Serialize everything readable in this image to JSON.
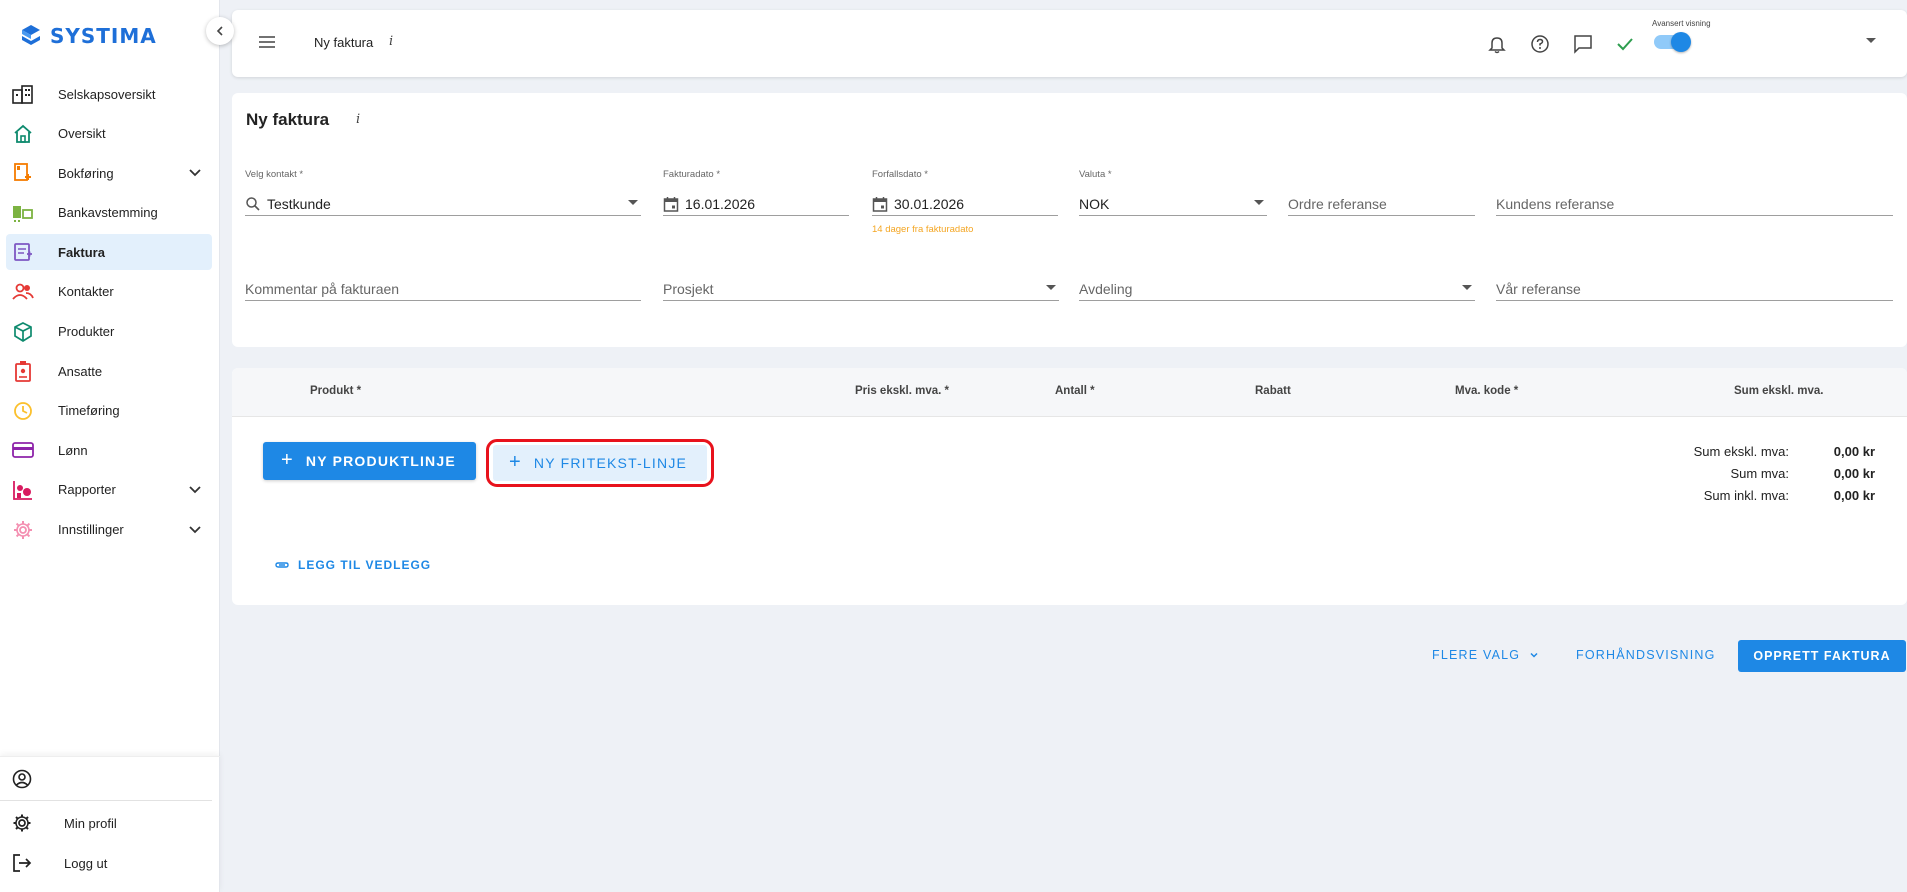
{
  "app": {
    "name": "SYSTIMA"
  },
  "sidebar": {
    "items": [
      {
        "label": "Selskapsoversikt",
        "icon": "buildings-icon",
        "color": "#222222"
      },
      {
        "label": "Oversikt",
        "icon": "home-icon",
        "color": "#0e8a6e"
      },
      {
        "label": "Bokføring",
        "icon": "ledger-icon",
        "color": "#f57c00",
        "expandable": true
      },
      {
        "label": "Bankavstemming",
        "icon": "bank-icon",
        "color": "#7cb342"
      },
      {
        "label": "Faktura",
        "icon": "invoice-icon",
        "color": "#7e57c2",
        "active": true
      },
      {
        "label": "Kontakter",
        "icon": "contacts-icon",
        "color": "#e53935"
      },
      {
        "label": "Produkter",
        "icon": "cube-icon",
        "color": "#0e8a6e"
      },
      {
        "label": "Ansatte",
        "icon": "badge-icon",
        "color": "#e53935"
      },
      {
        "label": "Timeføring",
        "icon": "clock-icon",
        "color": "#fbc02d"
      },
      {
        "label": "Lønn",
        "icon": "card-icon",
        "color": "#8e24aa"
      },
      {
        "label": "Rapporter",
        "icon": "chart-icon",
        "color": "#d81b60",
        "expandable": true
      },
      {
        "label": "Innstillinger",
        "icon": "gear-icon",
        "color": "#f48fb1",
        "expandable": true
      }
    ],
    "bottom": {
      "profile": "Min profil",
      "logout": "Logg ut"
    }
  },
  "topbar": {
    "title": "Ny faktura",
    "info": "i",
    "toggle_label": "Avansert visning",
    "toggle_on": true
  },
  "form": {
    "title": "Ny faktura",
    "info": "i",
    "contact": {
      "label": "Velg kontakt *",
      "value": "Testkunde"
    },
    "invoice_date": {
      "label": "Fakturadato *",
      "value": "16.01.2026"
    },
    "due_date": {
      "label": "Forfallsdato *",
      "value": "30.01.2026",
      "hint": "14 dager fra fakturadato"
    },
    "currency": {
      "label": "Valuta *",
      "value": "NOK"
    },
    "order_ref": {
      "placeholder": "Ordre referanse"
    },
    "customer_ref": {
      "placeholder": "Kundens referanse"
    },
    "comment": {
      "placeholder": "Kommentar på fakturaen"
    },
    "project": {
      "placeholder": "Prosjekt"
    },
    "department": {
      "placeholder": "Avdeling"
    },
    "our_ref": {
      "placeholder": "Vår referanse"
    }
  },
  "lines": {
    "columns": [
      "Produkt *",
      "Pris ekskl. mva. *",
      "Antall *",
      "Rabatt",
      "Mva. kode *",
      "Sum ekskl. mva."
    ],
    "new_product_line": "NY PRODUKTLINJE",
    "new_freetext_line": "NY FRITEKST-LINJE",
    "attach": "LEGG TIL VEDLEGG",
    "sums": [
      {
        "label": "Sum ekskl. mva:",
        "value": "0,00 kr"
      },
      {
        "label": "Sum mva:",
        "value": "0,00 kr"
      },
      {
        "label": "Sum inkl. mva:",
        "value": "0,00 kr"
      }
    ]
  },
  "actions": {
    "more": "FLERE VALG",
    "preview": "FORHÅNDSVISNING",
    "create": "OPPRETT FAKTURA"
  },
  "colors": {
    "primary": "#1e88e5",
    "highlight": "#e8121c",
    "hint": "#f4a623",
    "background": "#eef1f6"
  }
}
